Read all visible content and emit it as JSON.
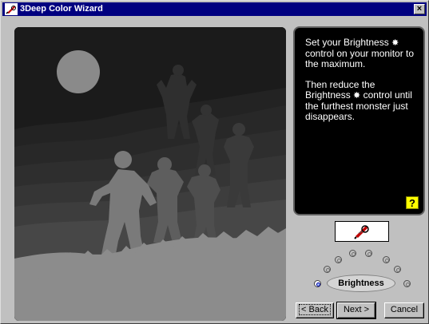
{
  "window": {
    "title": "3Deep Color Wizard",
    "close_glyph": "×"
  },
  "instructions": {
    "paragraph1_before": "Set your Brightness",
    "paragraph1_after": "control on your monitor to the maximum.",
    "paragraph2_before": "Then reduce the Brightness",
    "paragraph2_after": "control until the furthest monster just disappears.",
    "star_glyph": "✸"
  },
  "help_button": {
    "label": "?"
  },
  "dial": {
    "label": "Brightness",
    "setting_count": 9,
    "selected_setting": 1
  },
  "buttons": {
    "back": "< Back",
    "next": "Next >",
    "cancel": "Cancel"
  },
  "colors": {
    "titlebar": "#000080",
    "panel_bg": "#000000",
    "help_button": "#ffff00",
    "dialog_bg": "#c0c0c0"
  }
}
